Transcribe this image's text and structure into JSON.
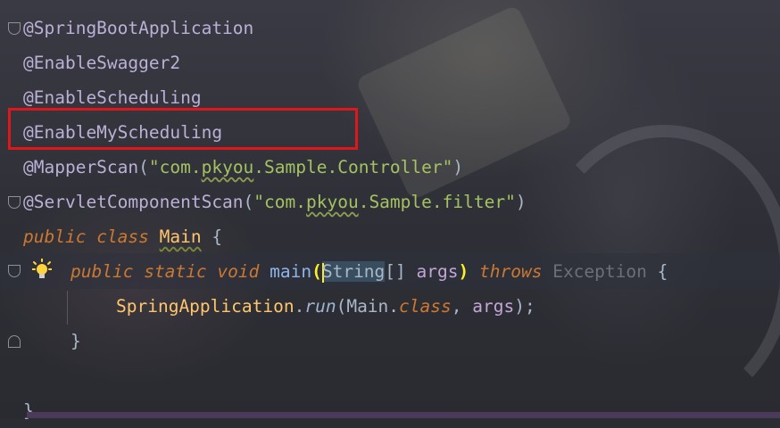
{
  "editor": {
    "lines": {
      "l1": "@SpringBootApplication",
      "l2": "@EnableSwagger2",
      "l3": "@EnableScheduling",
      "l4": "@EnableMyScheduling",
      "l5_ann": "@MapperScan",
      "l5_open": "(",
      "l5_str_a": "\"com.",
      "l5_str_typo": "pkyou",
      "l5_str_b": ".Sample.Controller\"",
      "l5_close": ")",
      "l6_ann": "@ServletComponentScan",
      "l6_open": "(",
      "l6_str_a": "\"com.",
      "l6_str_typo": "pkyou",
      "l6_str_b": ".Sample.filter\"",
      "l6_close": ")",
      "l7_public": "public",
      "l7_class": "class",
      "l7_name": "Main",
      "l7_brace": "{",
      "l8_public": "public",
      "l8_static": "static",
      "l8_void": "void",
      "l8_main": "main",
      "l8_paren_open": "(",
      "l8_type": "String",
      "l8_arr": "[]",
      "l8_args": "args",
      "l8_paren_close": ")",
      "l8_throws": "throws",
      "l8_exc": "Exception",
      "l8_brace": "{",
      "l9_cls": "SpringApplication",
      "l9_dot": ".",
      "l9_run": "run",
      "l9_open": "(",
      "l9_main": "Main",
      "l9_dot2": ".",
      "l9_class": "class",
      "l9_comma": ", ",
      "l9_args": "args",
      "l9_end": ");",
      "l10": "}",
      "l11": "}"
    },
    "icons": [
      "fold-icon",
      "lightbulb-icon"
    ],
    "highlight_color": "#e0171a"
  }
}
